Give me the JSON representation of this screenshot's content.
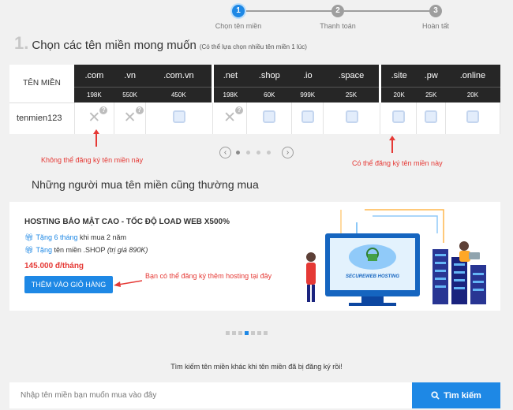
{
  "stepper": {
    "steps": [
      {
        "number": "1",
        "label": "Chọn tên miền",
        "active": true
      },
      {
        "number": "2",
        "label": "Thanh toán",
        "active": false
      },
      {
        "number": "3",
        "label": "Hoàn tất",
        "active": false
      }
    ]
  },
  "section": {
    "number": "1.",
    "title": "Chọn các tên miền mong muốn",
    "note": "(Có thể lựa chọn nhiều tên miền 1 lúc)"
  },
  "table": {
    "label_header": "Tên miền",
    "extensions": [
      ".com",
      ".vn",
      ".com.vn",
      ".net",
      ".shop",
      ".io",
      ".space",
      ".site",
      ".pw",
      ".online"
    ],
    "prices": [
      "198K",
      "550K",
      "450K",
      "198K",
      "60K",
      "999K",
      "25K",
      "20K",
      "25K",
      "20K"
    ],
    "domain_name": "tenmien123",
    "status": [
      "taken",
      "taken",
      "available",
      "taken",
      "available",
      "available",
      "available",
      "available",
      "available",
      "available"
    ]
  },
  "annotations": {
    "unavailable": "Không thể đăng ký tên miền này",
    "available": "Có thể đăng ký tên miền này",
    "hosting": "Bạn có thể đăng ký thêm hosting tại đây"
  },
  "others": {
    "title": "Những người mua tên miền cũng thường mua"
  },
  "banner": {
    "title": "HOSTING BẢO MẬT CAO - TỐC ĐỘ LOAD WEB X500%",
    "line1_blue": "Tặng 6 tháng",
    "line1_rest": "khi mua 2 năm",
    "line2_blue": "Tặng",
    "line2_rest": "tên miền .SHOP",
    "line2_italic": "(trị giá 890K)",
    "price": "145.000 đ/tháng",
    "button": "THÊM VÀO GIỎ HÀNG",
    "illus_text": "SECUREWEB HOSTING"
  },
  "search": {
    "label": "Tìm kiếm tên miền khác khi tên miền đã bị đăng ký rồi!",
    "placeholder": "Nhập tên miền bạn muốn mua vào đây",
    "button": "Tìm kiếm"
  },
  "colors": {
    "accent": "#1e88e5",
    "header_bg": "#262626",
    "note_red": "#e53935"
  }
}
